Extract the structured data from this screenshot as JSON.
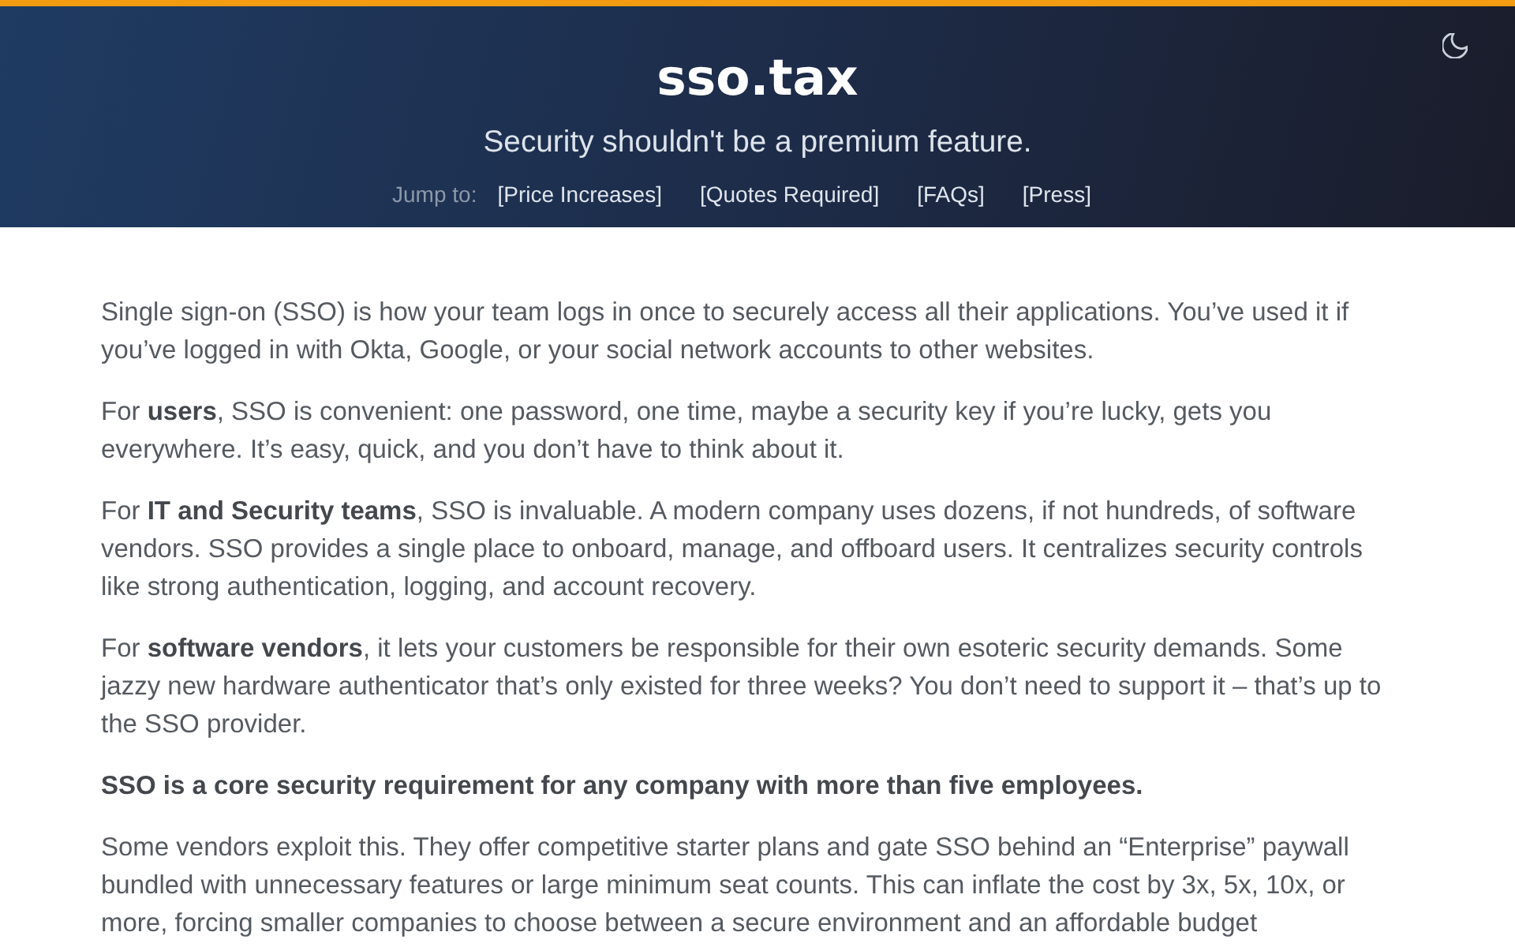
{
  "header": {
    "title": "sso.tax",
    "tagline": "Security shouldn't be a premium feature.",
    "jump_label": "Jump to:",
    "jump_links": [
      "[Price Increases]",
      "[Quotes Required]",
      "[FAQs]",
      "[Press]"
    ]
  },
  "paragraphs": [
    {
      "text": "Single sign-on (SSO) is how your team logs in once to securely access all their applications. You’ve used it if you’ve logged in with Okta, Google, or your social network accounts to other websites.",
      "bold": false
    },
    {
      "text": "For **users**, SSO is convenient: one password, one time, maybe a security key if you’re lucky, gets you everywhere. It’s easy, quick, and you don’t have to think about it.",
      "bold": false
    },
    {
      "text": "For **IT and Security teams**, SSO is invaluable. A modern company uses dozens, if not hundreds, of software vendors. SSO provides a single place to onboard, manage, and offboard users. It centralizes security controls like strong authentication, logging, and account recovery.",
      "bold": false
    },
    {
      "text": "For **software vendors**, it lets your customers be responsible for their own esoteric security demands. Some jazzy new hardware authenticator that’s only existed for three weeks? You don’t need to support it – that’s up to the SSO provider.",
      "bold": false
    },
    {
      "text": "SSO is a core security requirement for any company with more than five employees.",
      "bold": true
    },
    {
      "text": "Some vendors exploit this. They offer competitive starter plans and gate SSO behind an “Enterprise” paywall bundled with unnecessary features or large minimum seat counts. This can inflate the cost by 3x, 5x, 10x, or more, forcing smaller companies to choose between a secure environment and an affordable budget",
      "bold": false
    }
  ]
}
